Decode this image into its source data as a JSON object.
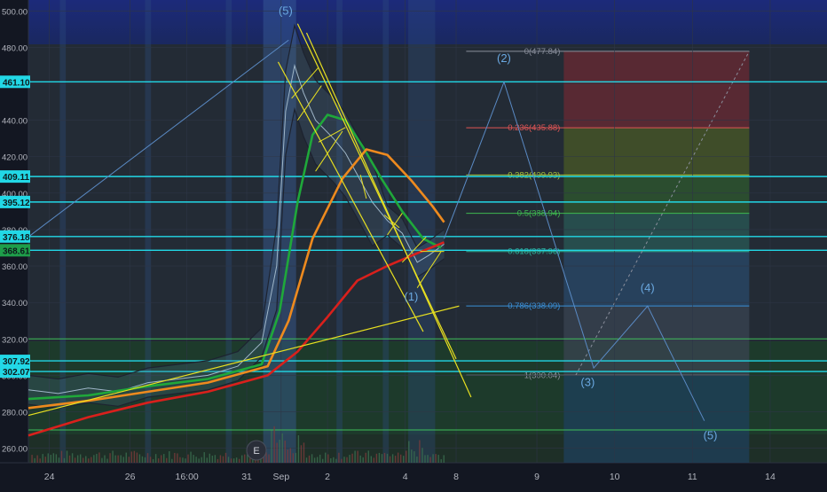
{
  "chart_data": {
    "type": "line",
    "title": "",
    "ylim": [
      252,
      506
    ],
    "y_ticks": [
      260,
      280,
      300,
      320,
      340,
      360,
      380,
      400,
      420,
      440,
      460,
      480,
      500
    ],
    "y_tick_labels": [
      "260.00",
      "280.00",
      "300.00",
      "320.00",
      "340.00",
      "360.00",
      "380.00",
      "400.00",
      "420.00",
      "440.00",
      "460.00",
      "480.00",
      "500.00"
    ],
    "x_ticks": [
      {
        "label": "24",
        "t": 0.7
      },
      {
        "label": "26",
        "t": 3.4
      },
      {
        "label": "16:00",
        "t": 5.3
      },
      {
        "label": "31",
        "t": 7.3
      },
      {
        "label": "Sep",
        "t": 8.45
      },
      {
        "label": "2",
        "t": 10.0
      },
      {
        "label": "4",
        "t": 12.6
      },
      {
        "label": "8",
        "t": 14.3
      },
      {
        "label": "9",
        "t": 17.0
      },
      {
        "label": "10",
        "t": 19.6
      },
      {
        "label": "11",
        "t": 22.2
      },
      {
        "label": "14",
        "t": 24.8
      }
    ],
    "x_range": [
      0,
      26.7
    ],
    "level_lines": [
      {
        "value": 461.1,
        "label": "461.10",
        "color": "#22d8e6"
      },
      {
        "value": 409.11,
        "label": "409.11",
        "color": "#22d8e6"
      },
      {
        "value": 395.12,
        "label": "395.12",
        "color": "#22d8e6"
      },
      {
        "value": 376.18,
        "label": "376.18",
        "color": "#22d8e6"
      },
      {
        "value": 368.61,
        "label": "368.61",
        "color": "#22d8e6",
        "tag": "green"
      },
      {
        "value": 307.92,
        "label": "307.92",
        "color": "#22d8e6"
      },
      {
        "value": 302.07,
        "label": "302.07",
        "color": "#22d8e6"
      }
    ],
    "fib_levels": [
      {
        "ratio": "0",
        "value": 477.84,
        "label": "0(477.84)",
        "color": "#8a8f9c"
      },
      {
        "ratio": "0.236",
        "value": 435.88,
        "label": "0.236(435.88)",
        "color": "#e05555"
      },
      {
        "ratio": "0.382",
        "value": 409.93,
        "label": "0.382(409.93)",
        "color": "#a8c23a"
      },
      {
        "ratio": "0.5",
        "value": 388.94,
        "label": "0.5(388.94)",
        "color": "#3fb950"
      },
      {
        "ratio": "0.618",
        "value": 367.96,
        "label": "0.618(367.96)",
        "color": "#2bb39a"
      },
      {
        "ratio": "0.786",
        "value": 338.09,
        "label": "0.786(338.09)",
        "color": "#3a8fd6"
      },
      {
        "ratio": "1",
        "value": 300.04,
        "label": "1(300.04)",
        "color": "#8a8f9c"
      }
    ],
    "wave_labels": [
      {
        "text": "(5)",
        "t": 8.6,
        "v": 498
      },
      {
        "text": "(1)",
        "t": 12.8,
        "v": 341
      },
      {
        "text": "(2)",
        "t": 15.9,
        "v": 472
      },
      {
        "text": "(3)",
        "t": 18.7,
        "v": 294
      },
      {
        "text": "(4)",
        "t": 20.7,
        "v": 346
      },
      {
        "text": "(5)",
        "t": 22.8,
        "v": 265
      }
    ],
    "projection_path": [
      {
        "t": 13.9,
        "v": 375
      },
      {
        "t": 15.9,
        "v": 461
      },
      {
        "t": 18.9,
        "v": 304
      },
      {
        "t": 20.7,
        "v": 338
      },
      {
        "t": 22.6,
        "v": 275
      }
    ],
    "price_series": [
      {
        "t": 0.0,
        "v": 292
      },
      {
        "t": 1.0,
        "v": 290
      },
      {
        "t": 2.0,
        "v": 293
      },
      {
        "t": 3.0,
        "v": 291
      },
      {
        "t": 4.0,
        "v": 296
      },
      {
        "t": 5.0,
        "v": 298
      },
      {
        "t": 6.0,
        "v": 300
      },
      {
        "t": 7.0,
        "v": 305
      },
      {
        "t": 7.8,
        "v": 318
      },
      {
        "t": 8.3,
        "v": 360
      },
      {
        "t": 8.6,
        "v": 445
      },
      {
        "t": 8.9,
        "v": 470
      },
      {
        "t": 9.2,
        "v": 455
      },
      {
        "t": 9.6,
        "v": 440
      },
      {
        "t": 10.2,
        "v": 430
      },
      {
        "t": 10.6,
        "v": 422
      },
      {
        "t": 11.0,
        "v": 410
      },
      {
        "t": 11.5,
        "v": 395
      },
      {
        "t": 12.0,
        "v": 385
      },
      {
        "t": 12.5,
        "v": 378
      },
      {
        "t": 13.0,
        "v": 362
      },
      {
        "t": 13.4,
        "v": 366
      },
      {
        "t": 13.9,
        "v": 372
      }
    ],
    "series": [
      {
        "name": "",
        "color": "#1fa83a",
        "values": [
          {
            "t": 0.0,
            "v": 287
          },
          {
            "t": 2.0,
            "v": 289
          },
          {
            "t": 4.0,
            "v": 294
          },
          {
            "t": 6.0,
            "v": 298
          },
          {
            "t": 7.8,
            "v": 306
          },
          {
            "t": 8.4,
            "v": 335
          },
          {
            "t": 9.0,
            "v": 395
          },
          {
            "t": 9.5,
            "v": 432
          },
          {
            "t": 10.0,
            "v": 443
          },
          {
            "t": 10.6,
            "v": 440
          },
          {
            "t": 11.2,
            "v": 425
          },
          {
            "t": 11.8,
            "v": 408
          },
          {
            "t": 12.5,
            "v": 390
          },
          {
            "t": 13.2,
            "v": 375
          },
          {
            "t": 13.8,
            "v": 370
          }
        ]
      },
      {
        "name": "",
        "color": "#ee8a1e",
        "values": [
          {
            "t": 0.0,
            "v": 282
          },
          {
            "t": 2.0,
            "v": 286
          },
          {
            "t": 4.0,
            "v": 291
          },
          {
            "t": 6.0,
            "v": 296
          },
          {
            "t": 8.0,
            "v": 305
          },
          {
            "t": 8.7,
            "v": 330
          },
          {
            "t": 9.5,
            "v": 375
          },
          {
            "t": 10.5,
            "v": 408
          },
          {
            "t": 11.3,
            "v": 424
          },
          {
            "t": 12.0,
            "v": 421
          },
          {
            "t": 12.8,
            "v": 407
          },
          {
            "t": 13.5,
            "v": 393
          },
          {
            "t": 13.9,
            "v": 384
          }
        ]
      },
      {
        "name": "",
        "color": "#d9201c",
        "values": [
          {
            "t": 0.0,
            "v": 267
          },
          {
            "t": 2.0,
            "v": 277
          },
          {
            "t": 4.0,
            "v": 285
          },
          {
            "t": 6.0,
            "v": 291
          },
          {
            "t": 8.0,
            "v": 300
          },
          {
            "t": 9.0,
            "v": 313
          },
          {
            "t": 10.0,
            "v": 332
          },
          {
            "t": 11.0,
            "v": 352
          },
          {
            "t": 12.0,
            "v": 360
          },
          {
            "t": 13.0,
            "v": 367
          },
          {
            "t": 13.9,
            "v": 373
          }
        ]
      }
    ],
    "marker_label": "E"
  }
}
